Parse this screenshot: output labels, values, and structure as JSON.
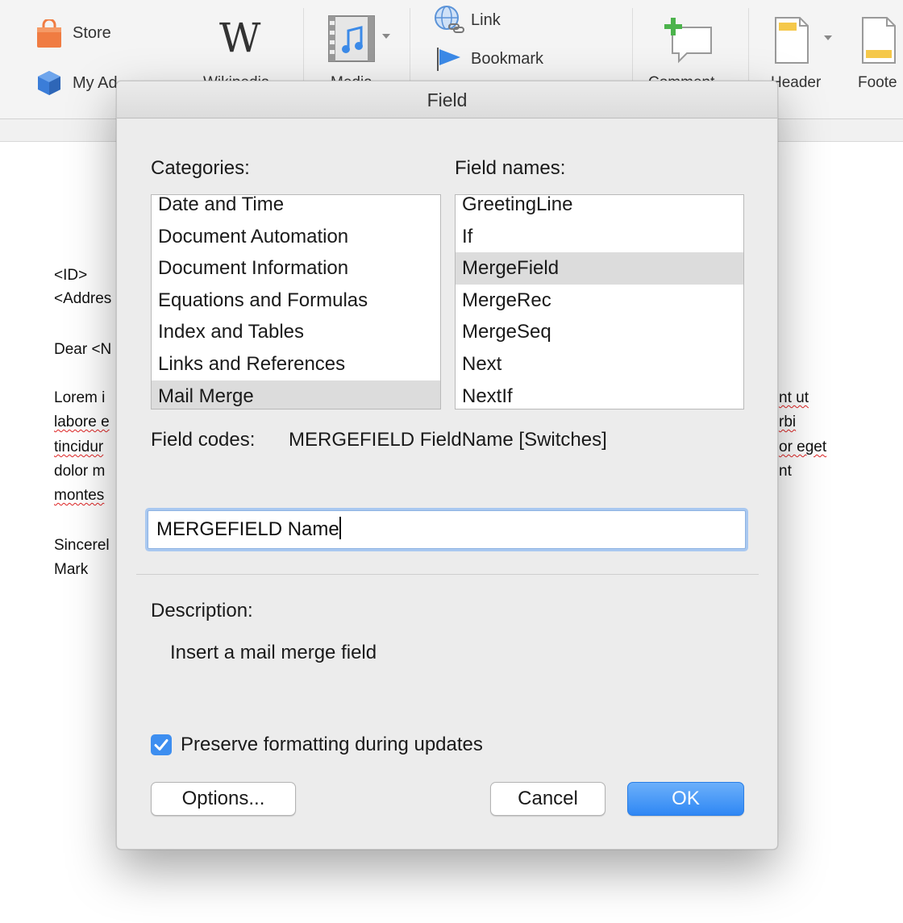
{
  "ribbon": {
    "store_label": "Store",
    "my_addins_label": "My Ad",
    "wikipedia_label": "Wikipedia",
    "media_label": "Media",
    "link_label": "Link",
    "bookmark_label": "Bookmark",
    "comment_label": "Comment",
    "header_label": "Header",
    "footer_label": "Foote"
  },
  "document": {
    "lines": [
      {
        "text": "<ID>",
        "squiggle": false
      },
      {
        "text": "<Addres",
        "squiggle": false
      },
      {
        "text": "Dear <N",
        "squiggle": false
      },
      {
        "text": "Lorem i",
        "squiggle": false
      },
      {
        "text": "labore e",
        "squiggle": true
      },
      {
        "text": "tincidur",
        "squiggle": true
      },
      {
        "text": "dolor m",
        "squiggle": false
      },
      {
        "text": "montes",
        "squiggle": true
      },
      {
        "text": "Sincerel",
        "squiggle": false
      },
      {
        "text": "Mark",
        "squiggle": false
      }
    ],
    "right_lines": [
      {
        "text": "nt ut",
        "squiggle": true
      },
      {
        "text": "rbi",
        "squiggle": true
      },
      {
        "text": "or eget",
        "squiggle": true
      },
      {
        "text": "nt",
        "squiggle": false
      }
    ]
  },
  "dialog": {
    "title": "Field",
    "categories_label": "Categories:",
    "field_names_label": "Field names:",
    "categories": [
      "Date and Time",
      "Document Automation",
      "Document Information",
      "Equations and Formulas",
      "Index and Tables",
      "Links and References",
      "Mail Merge"
    ],
    "selected_category": "Mail Merge",
    "field_names": [
      "GreetingLine",
      "If",
      "MergeField",
      "MergeRec",
      "MergeSeq",
      "Next",
      "NextIf"
    ],
    "selected_field_name": "MergeField",
    "field_codes_label": "Field codes:",
    "field_codes_value": "MERGEFIELD FieldName [Switches]",
    "field_input_value": "MERGEFIELD Name",
    "description_label": "Description:",
    "description_text": "Insert a mail merge field",
    "preserve_label": "Preserve formatting during updates",
    "preserve_checked": true,
    "options_label": "Options...",
    "cancel_label": "Cancel",
    "ok_label": "OK",
    "accent_color": "#3d8ef0"
  }
}
